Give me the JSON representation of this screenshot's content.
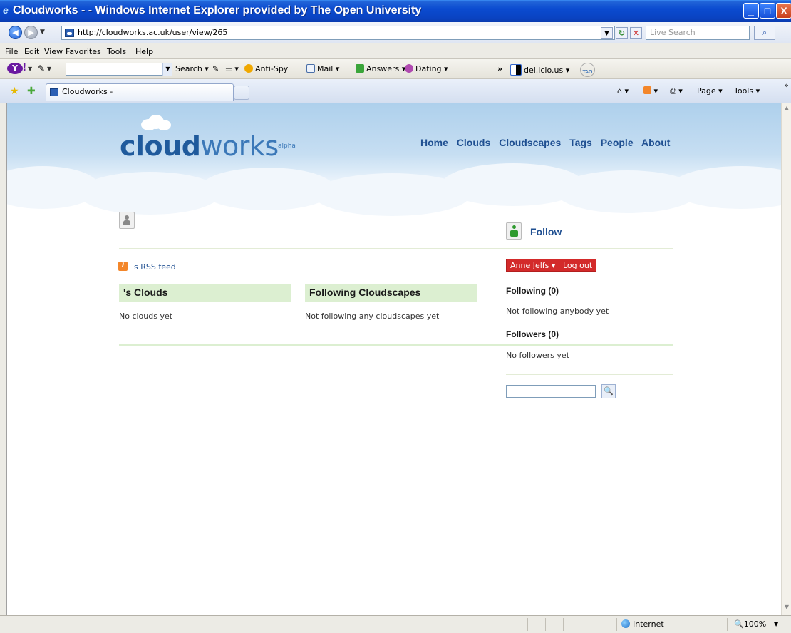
{
  "window": {
    "title": "Cloudworks - - Windows Internet Explorer provided by The Open University",
    "minimize": "_",
    "maximize": "□",
    "close": "X"
  },
  "address_bar": {
    "back_glyph": "◀",
    "forward_glyph": "▶",
    "dropdown_glyph": "▼",
    "url": "http://cloudworks.ac.uk/user/view/265",
    "refresh_glyph": "↻",
    "stop_glyph": "✕",
    "search_placeholder": "Live Search",
    "search_glyph": "⌕"
  },
  "menu": [
    "File",
    "Edit",
    "View",
    "Favorites",
    "Tools",
    "Help"
  ],
  "yahoo_toolbar": {
    "logo_glyph": "Y",
    "excl": "!",
    "pen_glyph": "✎",
    "drop_glyph": "▼",
    "search_label": "Search",
    "antispy_label": "Anti-Spy",
    "mail_label": "Mail",
    "answers_label": "Answers",
    "dating_label": "Dating",
    "more_glyph": "»",
    "delicious_label": "del.icio.us",
    "tag_label": "TAG"
  },
  "tabs": {
    "active_label": "Cloudworks -",
    "home_label": "⌂ ▾",
    "feeds_label": "▾",
    "print_label": "⎙ ▾",
    "page_label": "Page ▾",
    "tools_label": "Tools ▾",
    "more_glyph": "»"
  },
  "site": {
    "logo_bold": "cloud",
    "logo_rest": "works",
    "alpha": "alpha",
    "nav": [
      "Home",
      "Clouds",
      "Cloudscapes",
      "Tags",
      "People",
      "About"
    ]
  },
  "profile": {
    "rss_label": "'s RSS feed",
    "clouds_heading": "'s Clouds",
    "clouds_empty": "No clouds yet",
    "cloudscapes_heading": "Following Cloudscapes",
    "cloudscapes_empty": "Not following any cloudscapes yet"
  },
  "sidebar": {
    "follow_label": "Follow",
    "user_button": "Anne Jelfs ▾",
    "logout_button": "Log out",
    "following_heading": "Following (0)",
    "following_empty": "Not following anybody yet",
    "followers_heading": "Followers (0)",
    "followers_empty": "No followers yet",
    "search_value": "",
    "search_glyph": "🔍"
  },
  "status_bar": {
    "zone": "Internet",
    "zoom": "100%",
    "zoom_prefix": "🔍",
    "drop_glyph": "▼"
  },
  "scrollbar": {
    "up_glyph": "▲",
    "down_glyph": "▼"
  }
}
